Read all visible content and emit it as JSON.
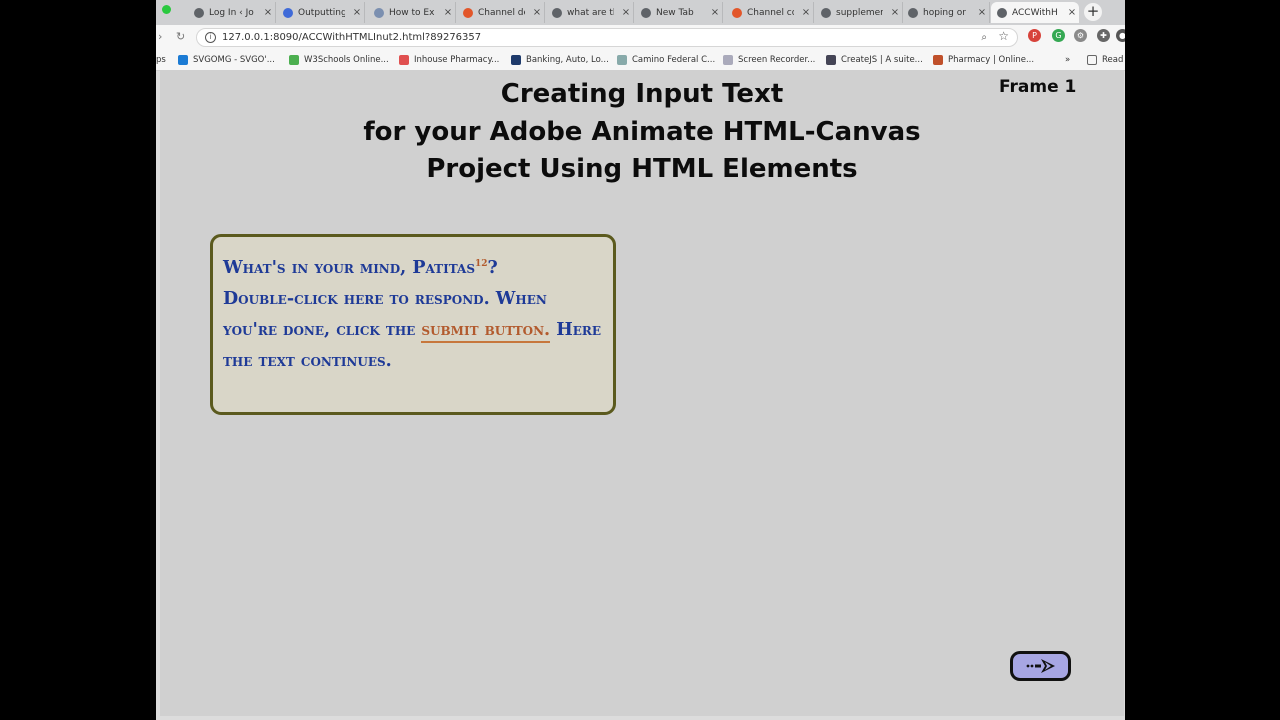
{
  "browser": {
    "tabs": [
      {
        "label": "Log In ‹ Jo",
        "icon": "globe-icon",
        "color": "#5f6368"
      },
      {
        "label": "Outputting",
        "icon": "video-icon",
        "color": "#3f6ad8"
      },
      {
        "label": "How to Ex",
        "icon": "cloud-icon",
        "color": "#7b8fb0"
      },
      {
        "label": "Channel de",
        "icon": "youtube-icon",
        "color": "#e2562a"
      },
      {
        "label": "what are th",
        "icon": "google-icon",
        "color": "#5f6368"
      },
      {
        "label": "New Tab",
        "icon": "chrome-icon",
        "color": "#5f6368"
      },
      {
        "label": "Channel co",
        "icon": "youtube-icon",
        "color": "#e2562a"
      },
      {
        "label": "supplemen",
        "icon": "google-icon",
        "color": "#5f6368"
      },
      {
        "label": "hoping or",
        "icon": "google-icon",
        "color": "#5f6368"
      },
      {
        "label": "ACCWithH",
        "icon": "globe-icon",
        "color": "#5f6368"
      }
    ],
    "new_tab_symbol": "+",
    "url": "127.0.0.1:8090/ACCWithHTMLInut2.html?89276357",
    "bookmarks": [
      {
        "label": "ps",
        "color": "#888888"
      },
      {
        "label": "SVGOMG - SVGO'...",
        "color": "#1b7bd4"
      },
      {
        "label": "W3Schools Online...",
        "color": "#4caf50"
      },
      {
        "label": "Inhouse Pharmacy...",
        "color": "#e05050"
      },
      {
        "label": "Banking, Auto, Lo...",
        "color": "#1e3a6b"
      },
      {
        "label": "Camino Federal C...",
        "color": "#8aa"
      },
      {
        "label": "Screen Recorder...",
        "color": "#aab"
      },
      {
        "label": "CreateJS | A suite...",
        "color": "#445"
      },
      {
        "label": "Pharmacy | Online...",
        "color": "#c0502a"
      }
    ],
    "more_bookmarks": "»",
    "reading_list": "Read"
  },
  "page": {
    "title_lines": [
      "Creating Input Text",
      "for your Adobe Animate HTML-Canvas",
      "Project Using HTML Elements"
    ],
    "frame_label": "Frame 1",
    "prompt": {
      "line1_pre": "What's in your mind, Patitas",
      "line1_sup": "12",
      "line1_post": "?",
      "body_pre": "Double-click here to respond. When you're done, click the ",
      "link": "submit button.",
      "body_post": " Here the text continues."
    },
    "nav_button_icon": "arrow-icon"
  },
  "colors": {
    "accent_text": "#1e3a97",
    "link_text": "#b25a2d",
    "nav_button_fill": "#a7a6e3"
  }
}
